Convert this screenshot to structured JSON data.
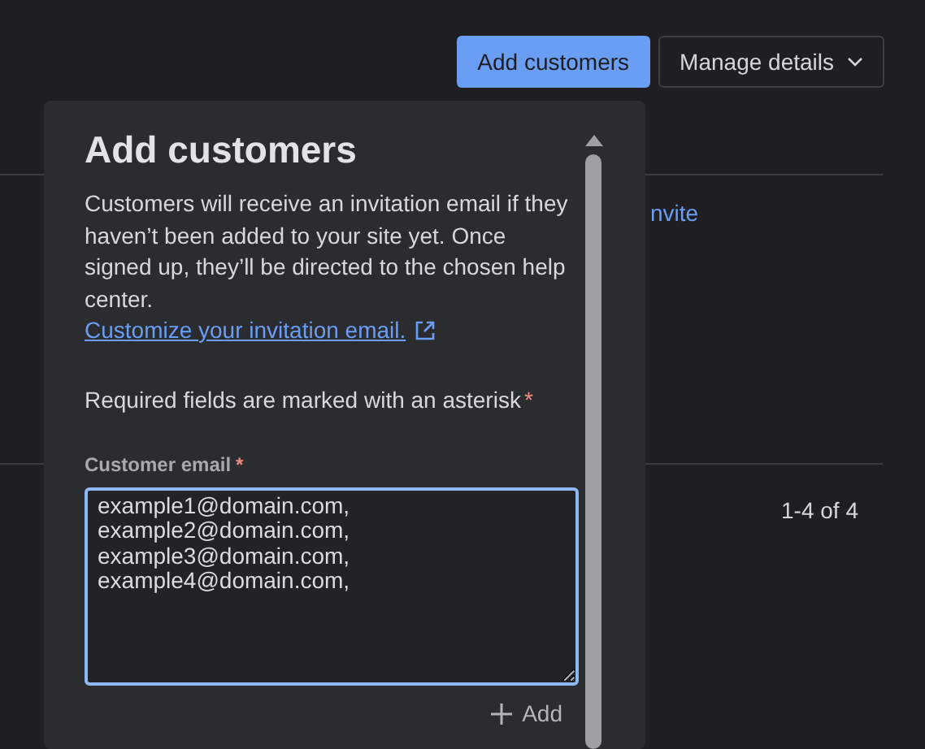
{
  "header_buttons": [
    {
      "label": "Add customers",
      "kind": "primary"
    },
    {
      "label": "Manage details",
      "kind": "dropdown"
    }
  ],
  "background": {
    "link": "nvite",
    "pagination": "1-4 of 4"
  },
  "dialog": {
    "title": "Add customers",
    "description": "Customers will receive an invitation email if they haven’t been added to your site yet. Once signed up, they’ll be directed to the chosen help center.",
    "link": "Customize your invitation email.",
    "required_note": "Required fields are marked with an asterisk",
    "required_mark": "*",
    "field": {
      "label": "Customer email",
      "required": true,
      "value": "example1@domain.com,\nexample2@domain.com,\nexample3@domain.com,\nexample4@domain.com,\n",
      "focused": true
    },
    "add_button": "Add"
  }
}
